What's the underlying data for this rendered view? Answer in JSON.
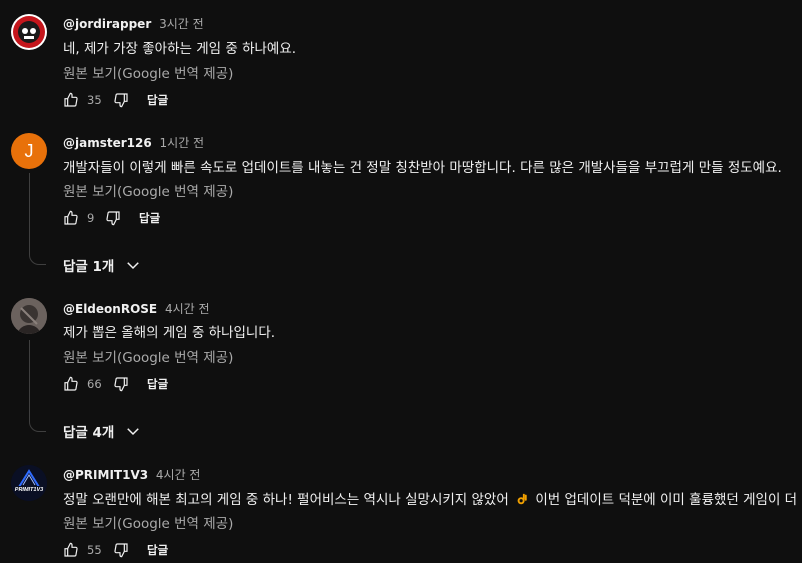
{
  "translate_label": "원본 보기(Google 번역 제공)",
  "reply_label": "답글",
  "comments": [
    {
      "author": "@jordirapper",
      "time": "3시간 전",
      "text": "네, 제가 가장 좋아하는 게임 중 하나예요.",
      "likes": "35",
      "avatar": {
        "type": "logo",
        "bg": "#ffffff",
        "accent": "#c4161c"
      }
    },
    {
      "author": "@jamster126",
      "time": "1시간 전",
      "text": "개발자들이 이렇게 빠른 속도로 업데이트를 내놓는 건 정말 칭찬받아 마땅합니다. 다른 많은 개발사들을 부끄럽게 만들 정도예요.",
      "likes": "9",
      "avatar": {
        "type": "letter",
        "letter": "J",
        "bg": "#e8710a"
      },
      "replies_label": "답글 1개"
    },
    {
      "author": "@EldeonROSE",
      "time": "4시간 전",
      "text": "제가 뽑은 올해의 게임 중 하나입니다.",
      "likes": "66",
      "avatar": {
        "type": "photo",
        "bg": "#5a5250"
      },
      "replies_label": "답글 4개"
    },
    {
      "author": "@PRIMIT1V3",
      "time": "4시간 전",
      "text_before_emoji": "정말 오랜만에 해본 최고의 게임 중 하나! 펄어비스는 역시나 실망시키지 않았어",
      "emoji": "ok-hand-emoji",
      "text_after_emoji": "이번 업데이트 덕분에 이미 훌륭했던 게임이 더",
      "likes": "55",
      "avatar": {
        "type": "logo",
        "bg": "#0a0f24",
        "accent": "#2f6bff",
        "label": "PRIMIT1V3"
      }
    }
  ]
}
